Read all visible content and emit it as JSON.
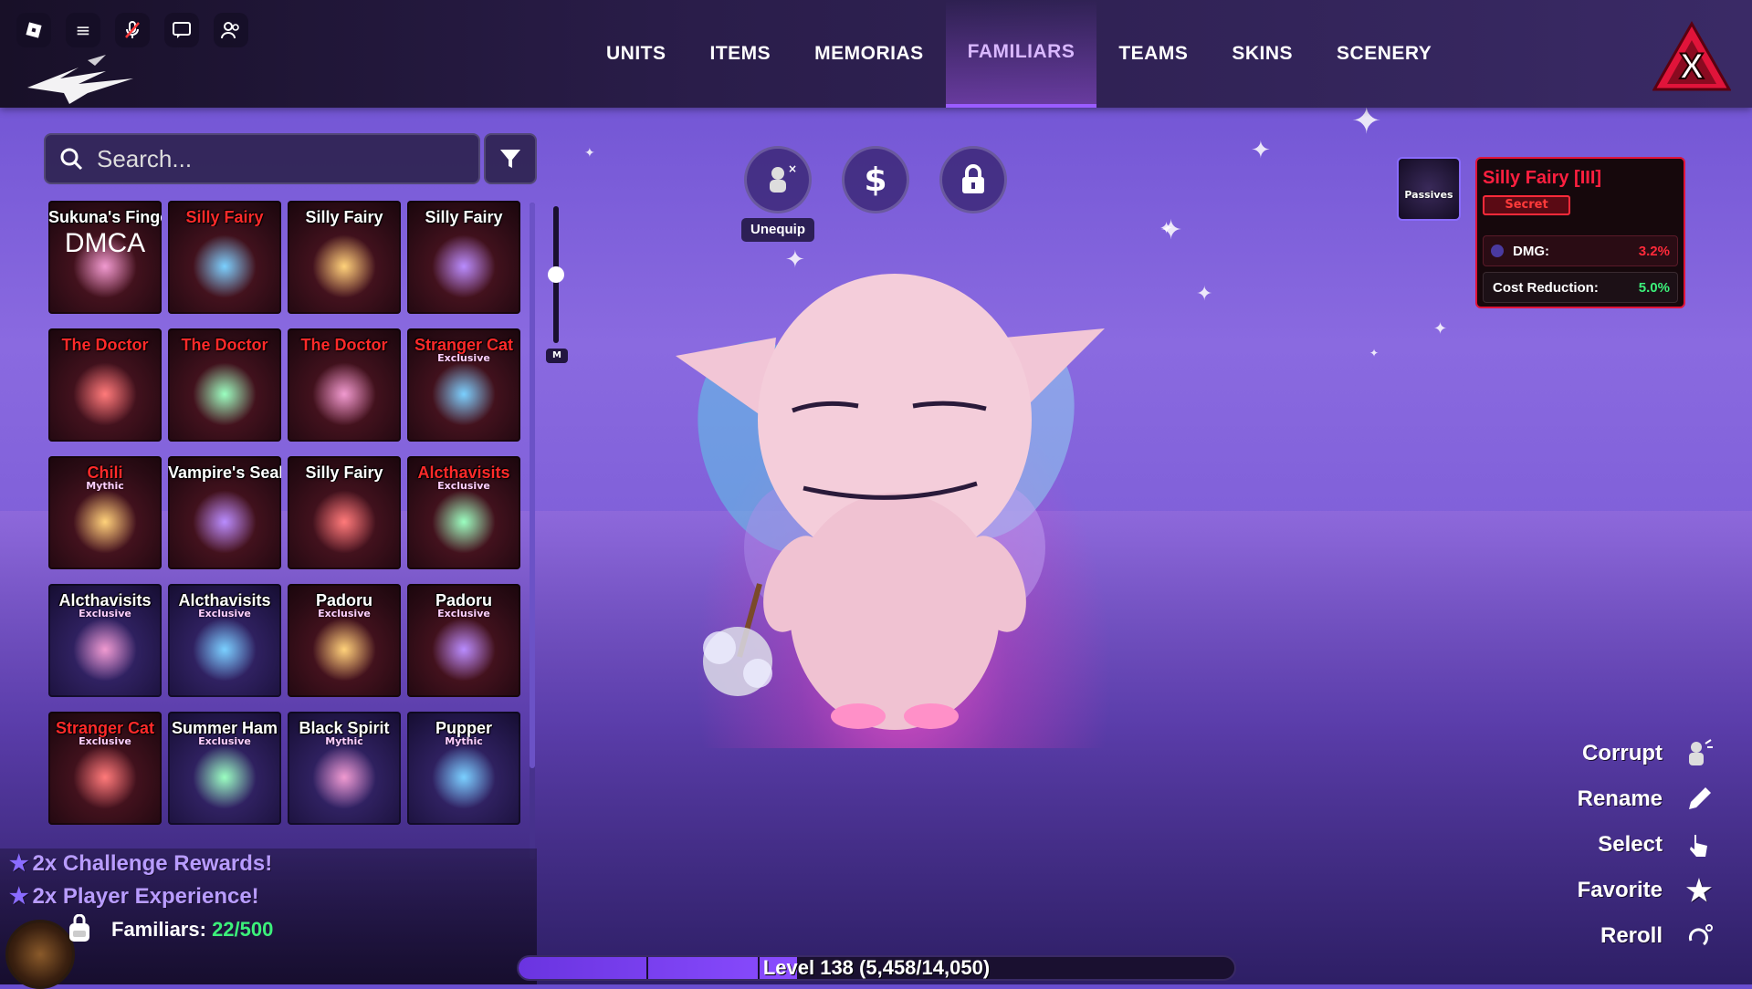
{
  "nav": {
    "tabs": [
      {
        "label": "UNITS"
      },
      {
        "label": "ITEMS"
      },
      {
        "label": "MEMORIAS"
      },
      {
        "label": "FAMILIARS"
      },
      {
        "label": "TEAMS"
      },
      {
        "label": "SKINS"
      },
      {
        "label": "SCENERY"
      }
    ],
    "active": "FAMILIARS"
  },
  "search": {
    "placeholder": "Search..."
  },
  "familiars": [
    {
      "name": "Sukuna's Finger",
      "subtitle": "DMCA",
      "rarity": "",
      "style": "dark"
    },
    {
      "name": "Silly Fairy",
      "rarity": "",
      "style": "red"
    },
    {
      "name": "Silly Fairy",
      "rarity": "",
      "style": "dark"
    },
    {
      "name": "Silly Fairy",
      "rarity": "",
      "style": "dark"
    },
    {
      "name": "The Doctor",
      "rarity": "",
      "style": "red"
    },
    {
      "name": "The Doctor",
      "rarity": "",
      "style": "red"
    },
    {
      "name": "The Doctor",
      "rarity": "",
      "style": "red"
    },
    {
      "name": "Stranger Cat",
      "rarity": "Exclusive",
      "style": "red"
    },
    {
      "name": "Chili",
      "rarity": "Mythic",
      "style": "red"
    },
    {
      "name": "Vampire's Seal",
      "rarity": "",
      "style": "dark"
    },
    {
      "name": "Silly Fairy",
      "rarity": "",
      "style": "dark"
    },
    {
      "name": "Alcthavisits",
      "rarity": "Exclusive",
      "style": "red"
    },
    {
      "name": "Alcthavisits",
      "rarity": "Exclusive",
      "style": "dark"
    },
    {
      "name": "Alcthavisits",
      "rarity": "Exclusive",
      "style": "dark"
    },
    {
      "name": "Padoru",
      "rarity": "Exclusive",
      "style": "dark"
    },
    {
      "name": "Padoru",
      "rarity": "Exclusive",
      "style": "dark"
    },
    {
      "name": "Stranger Cat",
      "rarity": "Exclusive",
      "style": "red"
    },
    {
      "name": "Summer Ham",
      "rarity": "Exclusive",
      "style": "dark"
    },
    {
      "name": "Black Spirit",
      "rarity": "Mythic",
      "style": "dark"
    },
    {
      "name": "Pupper",
      "rarity": "Mythic",
      "style": "dark"
    }
  ],
  "zoom_label": "M",
  "boosts": [
    "2x Challenge Rewards!",
    "2x Player Experience!"
  ],
  "familiars_count": {
    "label": "Familiars:",
    "value": "22/500"
  },
  "actions_top": {
    "unequip_label": "Unequip",
    "currency_symbol": "$"
  },
  "selected": {
    "passives_label": "Passives",
    "name": "Silly Fairy [III]",
    "rarity": "Secret",
    "stats": [
      {
        "label": "DMG:",
        "value": "3.2%",
        "color": "#ff2a3a"
      },
      {
        "label": "Cost Reduction:",
        "value": "5.0%",
        "color": "#3cf07a"
      }
    ]
  },
  "actions_right": [
    {
      "label": "Corrupt",
      "icon": "corrupt-icon"
    },
    {
      "label": "Rename",
      "icon": "pencil-icon"
    },
    {
      "label": "Select",
      "icon": "pointer-icon"
    },
    {
      "label": "Favorite",
      "icon": "star-icon"
    },
    {
      "label": "Reroll",
      "icon": "reroll-icon"
    }
  ],
  "level": {
    "text": "Level 138 (5,458/14,050)",
    "progress": 0.3885
  },
  "colors": {
    "accent": "#9a5cff",
    "secret_red": "#ff1f3f",
    "count_green": "#3cf07a"
  }
}
